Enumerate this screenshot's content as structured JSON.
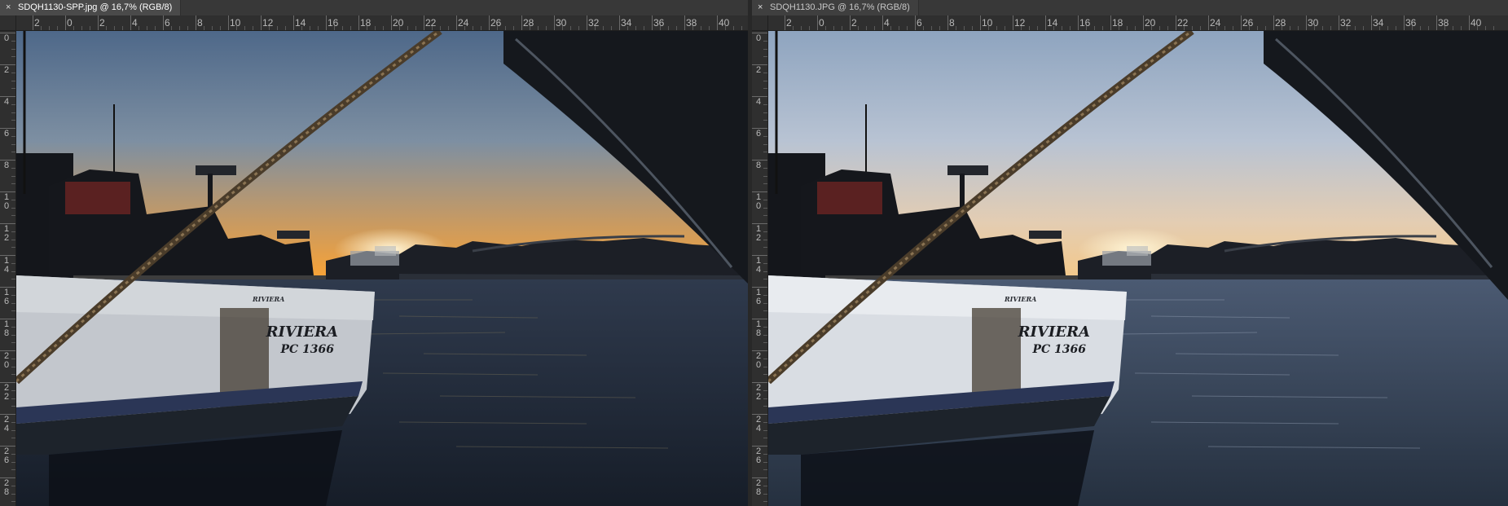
{
  "documents": [
    {
      "tab_title": "SDQH1130-SPP.jpg @ 16,7% (RGB/8)",
      "close_glyph": "×",
      "top_ruler_labels": [
        "2",
        "0",
        "2",
        "4",
        "6",
        "8",
        "10",
        "12",
        "14",
        "16",
        "18",
        "20",
        "22",
        "24",
        "26",
        "28",
        "30",
        "32",
        "34",
        "36",
        "38",
        "40"
      ],
      "left_ruler_labels": [
        "0",
        "2",
        "4",
        "6",
        "8",
        "10",
        "12",
        "14",
        "16",
        "18",
        "20",
        "22",
        "24",
        "26",
        "28"
      ],
      "hull_name": "RIVIERA",
      "hull_reg": "PC 1366",
      "hull_side_name": "RIVIERA",
      "sky_colors": [
        "#4e6889",
        "#7d8fa2",
        "#c79a63",
        "#f6a238"
      ]
    },
    {
      "tab_title": "SDQH1130.JPG @ 16,7% (RGB/8)",
      "close_glyph": "×",
      "top_ruler_labels": [
        "2",
        "0",
        "2",
        "4",
        "6",
        "8",
        "10",
        "12",
        "14",
        "16",
        "18",
        "20",
        "22",
        "24",
        "26",
        "28",
        "30",
        "32",
        "34",
        "36",
        "38",
        "40"
      ],
      "left_ruler_labels": [
        "0",
        "2",
        "4",
        "6",
        "8",
        "10",
        "12",
        "14",
        "16",
        "18",
        "20",
        "22",
        "24",
        "26",
        "28"
      ],
      "hull_name": "RIVIERA",
      "hull_reg": "PC 1366",
      "hull_side_name": "RIVIERA",
      "sky_colors": [
        "#8ea4bf",
        "#b8c3d3",
        "#e3cdb3",
        "#f3c98c"
      ]
    }
  ]
}
